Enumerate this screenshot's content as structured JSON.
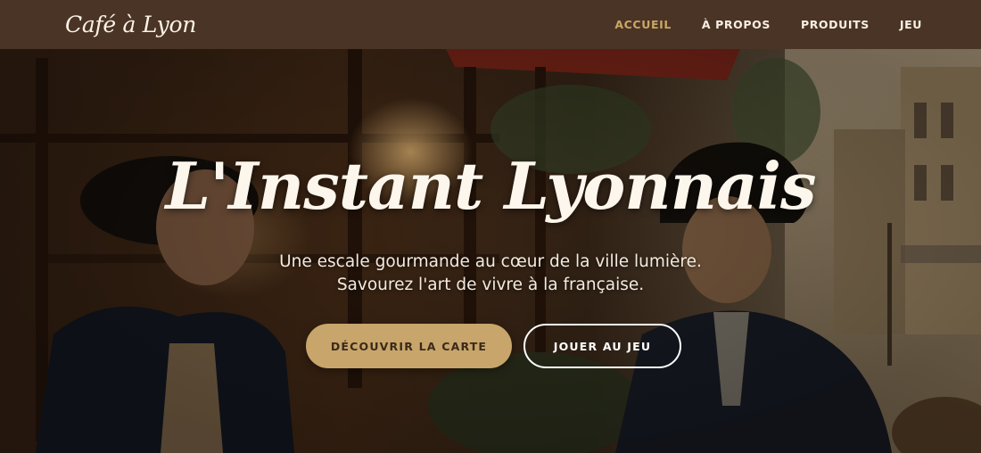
{
  "brand": {
    "name": "Café à Lyon"
  },
  "nav": {
    "items": [
      {
        "label": "ACCUEIL",
        "active": true
      },
      {
        "label": "À PROPOS",
        "active": false
      },
      {
        "label": "PRODUITS",
        "active": false
      },
      {
        "label": "JEU",
        "active": false
      }
    ]
  },
  "hero": {
    "title": "L'Instant Lyonnais",
    "subtitle": "Une escale gourmande au cœur de la ville lumière. Savourez l'art de vivre à la française.",
    "primary_button": "DÉCOUVRIR LA CARTE",
    "secondary_button": "JOUER AU JEU"
  },
  "colors": {
    "navbar_bg": "#4a3426",
    "accent_gold": "#c9a765",
    "button_primary_bg": "#c8a56a",
    "button_primary_text": "#3b2a1c"
  }
}
